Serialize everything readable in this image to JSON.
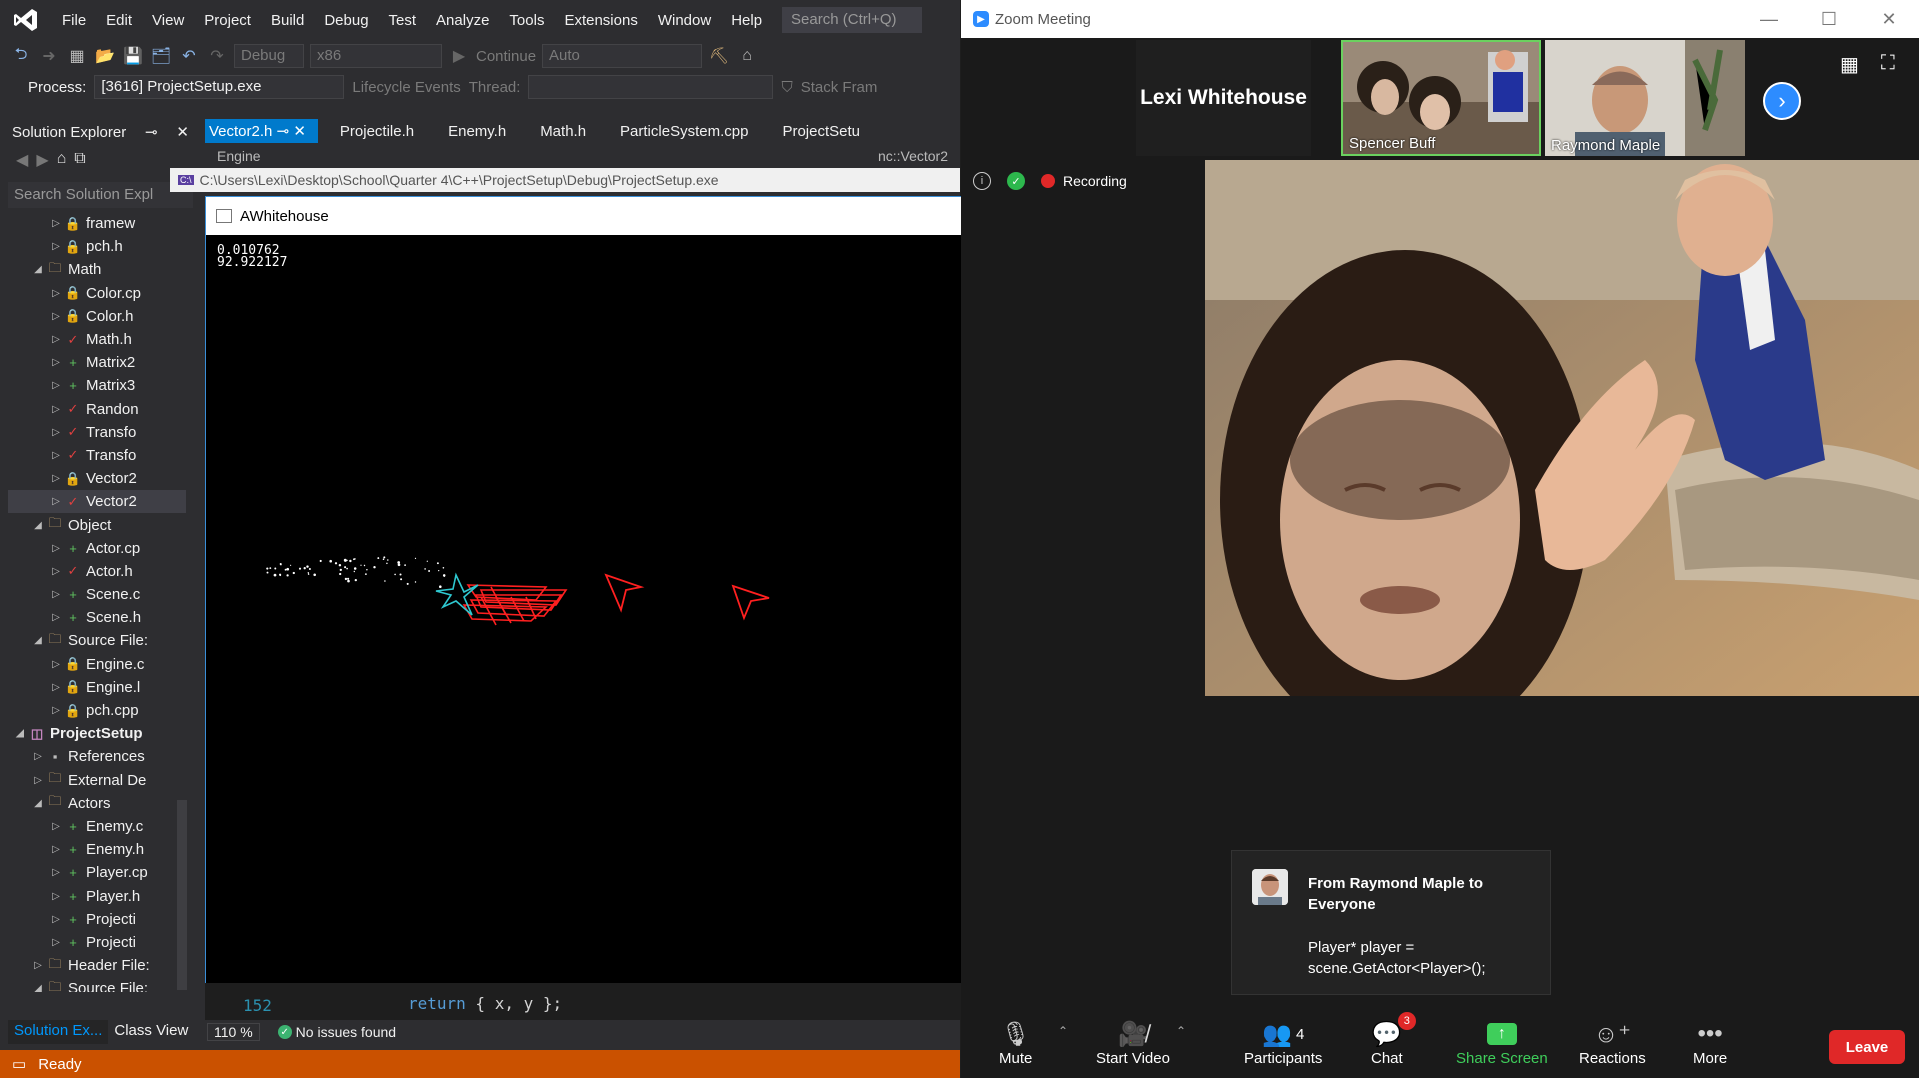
{
  "vs": {
    "menu": [
      "File",
      "Edit",
      "View",
      "Project",
      "Build",
      "Debug",
      "Test",
      "Analyze",
      "Tools",
      "Extensions",
      "Window",
      "Help"
    ],
    "search_placeholder": "Search (Ctrl+Q)",
    "toolbar": {
      "config": "Debug",
      "platform": "x86",
      "continue_label": "Continue",
      "auto_label": "Auto"
    },
    "process_bar": {
      "label": "Process:",
      "process": "[3616] ProjectSetup.exe",
      "lifecycle": "Lifecycle Events",
      "thread_label": "Thread:",
      "stack_frame": "Stack Fram"
    },
    "solution_explorer": {
      "title": "Solution Explorer",
      "search_placeholder": "Search Solution Expl",
      "tree": [
        {
          "label": "framew",
          "depth": 2,
          "icon": "lock"
        },
        {
          "label": "pch.h",
          "depth": 2,
          "icon": "lock"
        },
        {
          "label": "Math",
          "depth": 1,
          "icon": "folder",
          "expanded": true
        },
        {
          "label": "Color.cp",
          "depth": 2,
          "icon": "lock"
        },
        {
          "label": "Color.h",
          "depth": 2,
          "icon": "lock"
        },
        {
          "label": "Math.h",
          "depth": 2,
          "icon": "check"
        },
        {
          "label": "Matrix2",
          "depth": 2,
          "icon": "plus"
        },
        {
          "label": "Matrix3",
          "depth": 2,
          "icon": "plus"
        },
        {
          "label": "Randon",
          "depth": 2,
          "icon": "check"
        },
        {
          "label": "Transfo",
          "depth": 2,
          "icon": "check"
        },
        {
          "label": "Transfo",
          "depth": 2,
          "icon": "check"
        },
        {
          "label": "Vector2",
          "depth": 2,
          "icon": "lock"
        },
        {
          "label": "Vector2",
          "depth": 2,
          "icon": "check",
          "selected": true
        },
        {
          "label": "Object",
          "depth": 1,
          "icon": "folder",
          "expanded": true
        },
        {
          "label": "Actor.cp",
          "depth": 2,
          "icon": "plus"
        },
        {
          "label": "Actor.h",
          "depth": 2,
          "icon": "check"
        },
        {
          "label": "Scene.c",
          "depth": 2,
          "icon": "plus"
        },
        {
          "label": "Scene.h",
          "depth": 2,
          "icon": "plus"
        },
        {
          "label": "Source File:",
          "depth": 1,
          "icon": "folder",
          "expanded": true
        },
        {
          "label": "Engine.c",
          "depth": 2,
          "icon": "lock"
        },
        {
          "label": "Engine.l",
          "depth": 2,
          "icon": "lock"
        },
        {
          "label": "pch.cpp",
          "depth": 2,
          "icon": "lock"
        },
        {
          "label": "ProjectSetup",
          "depth": 0,
          "icon": "project",
          "expanded": true,
          "bold": true
        },
        {
          "label": "References",
          "depth": 1,
          "icon": "refs"
        },
        {
          "label": "External De",
          "depth": 1,
          "icon": "folder"
        },
        {
          "label": "Actors",
          "depth": 1,
          "icon": "folder",
          "expanded": true
        },
        {
          "label": "Enemy.c",
          "depth": 2,
          "icon": "plus"
        },
        {
          "label": "Enemy.h",
          "depth": 2,
          "icon": "plus"
        },
        {
          "label": "Player.cp",
          "depth": 2,
          "icon": "plus"
        },
        {
          "label": "Player.h",
          "depth": 2,
          "icon": "plus"
        },
        {
          "label": "Projecti",
          "depth": 2,
          "icon": "plus"
        },
        {
          "label": "Projecti",
          "depth": 2,
          "icon": "plus"
        },
        {
          "label": "Header File:",
          "depth": 1,
          "icon": "folder"
        },
        {
          "label": "Source File:",
          "depth": 1,
          "icon": "folder",
          "expanded": true
        }
      ],
      "bottom_tabs": [
        "Solution Ex...",
        "Class View"
      ]
    },
    "doc_tabs": [
      "Vector2.h",
      "Projectile.h",
      "Enemy.h",
      "Math.h",
      "ParticleSystem.cpp",
      "ProjectSetu"
    ],
    "nav_left": "Engine",
    "nav_right": "nc::Vector2",
    "editor": {
      "line_number": "152",
      "code_keyword": "return",
      "code_rest": " { x, y };"
    },
    "zoom_level": "110 %",
    "issues": "No issues found",
    "status": "Ready"
  },
  "console_path": "C:\\Users\\Lexi\\Desktop\\School\\Quarter 4\\C++\\ProjectSetup\\Debug\\ProjectSetup.exe",
  "game": {
    "title": "AWhitehouse",
    "readout_line1": "0.010762",
    "readout_line2": "92.922127",
    "colors": {
      "enemy": "#ff2020",
      "player": "#2ec8d0",
      "particles": "#ffffff"
    }
  },
  "zoom": {
    "title": "Zoom Meeting",
    "speaker_name": "Lexi Whitehouse",
    "participants": [
      "Spencer Buff",
      "Raymond Maple"
    ],
    "recording_label": "Recording",
    "chat": {
      "from": "From Raymond Maple to Everyone",
      "message_line1": "Player* player =",
      "message_line2": "scene.GetActor<Player>();"
    },
    "toolbar": {
      "mute": "Mute",
      "start_video": "Start Video",
      "participants": "Participants",
      "participants_count": "4",
      "chat": "Chat",
      "chat_badge": "3",
      "share_screen": "Share Screen",
      "reactions": "Reactions",
      "more": "More",
      "leave": "Leave"
    },
    "accent": "#2d8cff",
    "leave_color": "#e02828",
    "share_color": "#3fce5b"
  }
}
